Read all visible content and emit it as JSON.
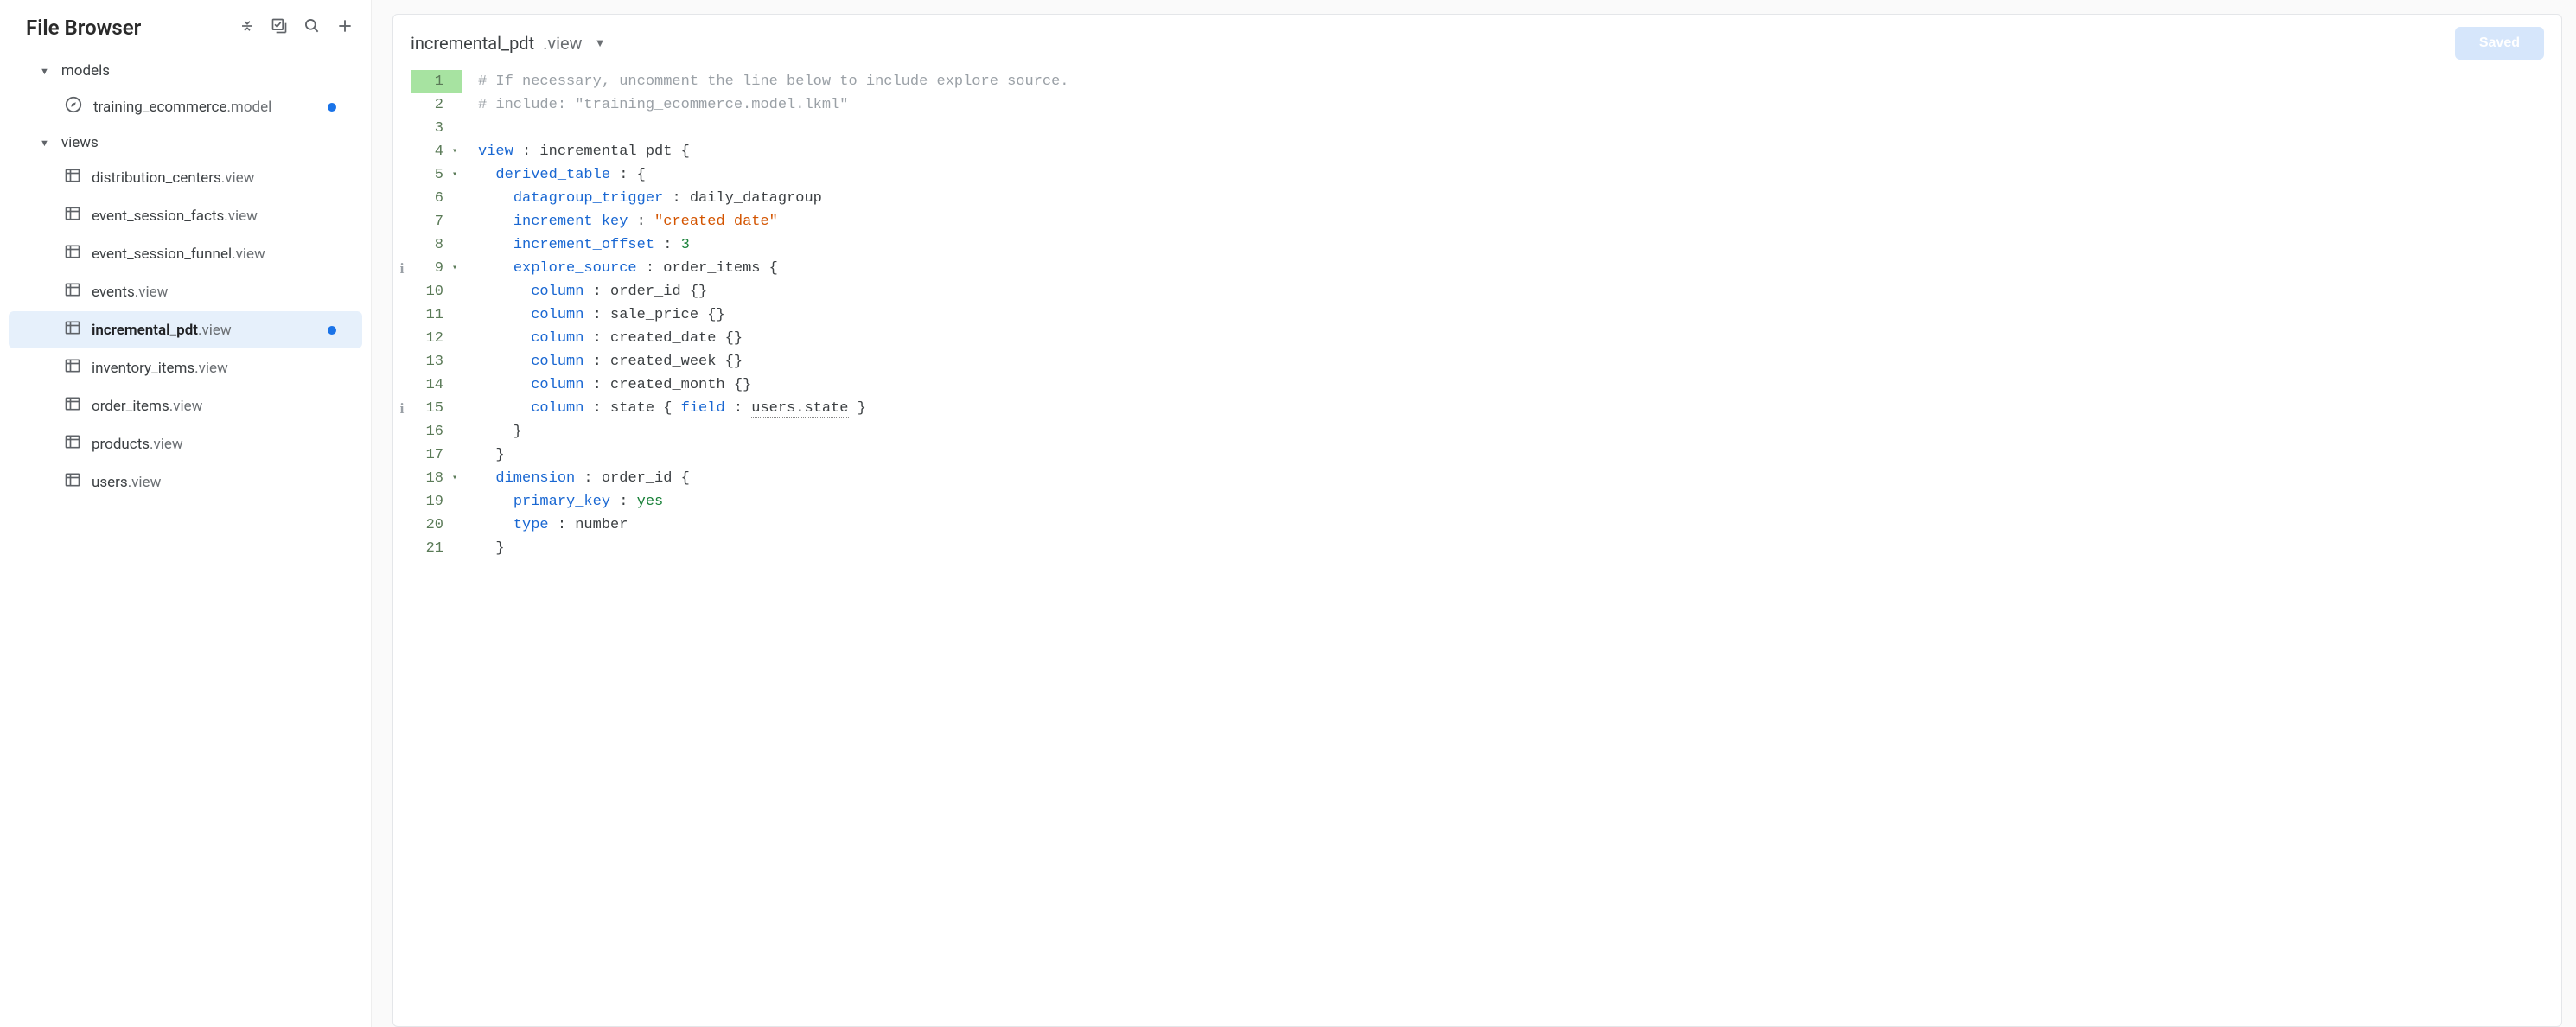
{
  "sidebar": {
    "title": "File Browser",
    "folders": {
      "models": {
        "label": "models"
      },
      "views": {
        "label": "views"
      }
    },
    "models": [
      {
        "name": "training_ecommerce",
        "ext": ".model",
        "dirty": true
      }
    ],
    "views": [
      {
        "name": "distribution_centers",
        "ext": ".view",
        "dirty": false,
        "active": false
      },
      {
        "name": "event_session_facts",
        "ext": ".view",
        "dirty": false,
        "active": false
      },
      {
        "name": "event_session_funnel",
        "ext": ".view",
        "dirty": false,
        "active": false
      },
      {
        "name": "events",
        "ext": ".view",
        "dirty": false,
        "active": false
      },
      {
        "name": "incremental_pdt",
        "ext": ".view",
        "dirty": true,
        "active": true
      },
      {
        "name": "inventory_items",
        "ext": ".view",
        "dirty": false,
        "active": false
      },
      {
        "name": "order_items",
        "ext": ".view",
        "dirty": false,
        "active": false
      },
      {
        "name": "products",
        "ext": ".view",
        "dirty": false,
        "active": false
      },
      {
        "name": "users",
        "ext": ".view",
        "dirty": false,
        "active": false
      }
    ]
  },
  "editor": {
    "filename_main": "incremental_pdt",
    "filename_ext": ".view",
    "status_label": "Saved",
    "lines": [
      {
        "n": 1,
        "info": "",
        "fold": "",
        "tokens": [
          [
            "c-comment",
            "# If necessary, uncomment the line below to include explore_source."
          ]
        ]
      },
      {
        "n": 2,
        "info": "",
        "fold": "",
        "tokens": [
          [
            "c-comment",
            "# include: \"training_ecommerce.model.lkml\""
          ]
        ]
      },
      {
        "n": 3,
        "info": "",
        "fold": "",
        "tokens": []
      },
      {
        "n": 4,
        "info": "",
        "fold": "▾",
        "tokens": [
          [
            "c-key",
            "view"
          ],
          [
            "",
            " : incremental_pdt {"
          ]
        ]
      },
      {
        "n": 5,
        "info": "",
        "fold": "▾",
        "tokens": [
          [
            "",
            "  "
          ],
          [
            "c-key",
            "derived_table"
          ],
          [
            "",
            " : {"
          ]
        ]
      },
      {
        "n": 6,
        "info": "",
        "fold": "",
        "tokens": [
          [
            "",
            "    "
          ],
          [
            "c-key",
            "datagroup_trigger"
          ],
          [
            "",
            " : daily_datagroup"
          ]
        ]
      },
      {
        "n": 7,
        "info": "",
        "fold": "",
        "tokens": [
          [
            "",
            "    "
          ],
          [
            "c-key",
            "increment_key"
          ],
          [
            "",
            " : "
          ],
          [
            "c-str",
            "\"created_date\""
          ]
        ]
      },
      {
        "n": 8,
        "info": "",
        "fold": "",
        "tokens": [
          [
            "",
            "    "
          ],
          [
            "c-key",
            "increment_offset"
          ],
          [
            "",
            " : "
          ],
          [
            "c-num",
            "3"
          ]
        ]
      },
      {
        "n": 9,
        "info": "i",
        "fold": "▾",
        "tokens": [
          [
            "",
            "    "
          ],
          [
            "c-key",
            "explore_source"
          ],
          [
            "",
            " : "
          ],
          [
            "c-dotted",
            "order_items"
          ],
          [
            "",
            " {"
          ]
        ]
      },
      {
        "n": 10,
        "info": "",
        "fold": "",
        "tokens": [
          [
            "",
            "      "
          ],
          [
            "c-key",
            "column"
          ],
          [
            "",
            " : order_id {}"
          ]
        ]
      },
      {
        "n": 11,
        "info": "",
        "fold": "",
        "tokens": [
          [
            "",
            "      "
          ],
          [
            "c-key",
            "column"
          ],
          [
            "",
            " : sale_price {}"
          ]
        ]
      },
      {
        "n": 12,
        "info": "",
        "fold": "",
        "tokens": [
          [
            "",
            "      "
          ],
          [
            "c-key",
            "column"
          ],
          [
            "",
            " : created_date {}"
          ]
        ]
      },
      {
        "n": 13,
        "info": "",
        "fold": "",
        "tokens": [
          [
            "",
            "      "
          ],
          [
            "c-key",
            "column"
          ],
          [
            "",
            " : created_week {}"
          ]
        ]
      },
      {
        "n": 14,
        "info": "",
        "fold": "",
        "tokens": [
          [
            "",
            "      "
          ],
          [
            "c-key",
            "column"
          ],
          [
            "",
            " : created_month {}"
          ]
        ]
      },
      {
        "n": 15,
        "info": "i",
        "fold": "",
        "tokens": [
          [
            "",
            "      "
          ],
          [
            "c-key",
            "column"
          ],
          [
            "",
            " : state { "
          ],
          [
            "c-key",
            "field"
          ],
          [
            "",
            " : "
          ],
          [
            "c-dotted",
            "users.state"
          ],
          [
            "",
            " }"
          ]
        ]
      },
      {
        "n": 16,
        "info": "",
        "fold": "",
        "tokens": [
          [
            "",
            "    }"
          ]
        ]
      },
      {
        "n": 17,
        "info": "",
        "fold": "",
        "tokens": [
          [
            "",
            "  }"
          ]
        ]
      },
      {
        "n": 18,
        "info": "",
        "fold": "▾",
        "tokens": [
          [
            "",
            "  "
          ],
          [
            "c-key",
            "dimension"
          ],
          [
            "",
            " : order_id {"
          ]
        ]
      },
      {
        "n": 19,
        "info": "",
        "fold": "",
        "tokens": [
          [
            "",
            "    "
          ],
          [
            "c-key",
            "primary_key"
          ],
          [
            "",
            " : "
          ],
          [
            "c-val",
            "yes"
          ]
        ]
      },
      {
        "n": 20,
        "info": "",
        "fold": "",
        "tokens": [
          [
            "",
            "    "
          ],
          [
            "c-key",
            "type"
          ],
          [
            "",
            " : number"
          ]
        ]
      },
      {
        "n": 21,
        "info": "",
        "fold": "",
        "tokens": [
          [
            "",
            "  }"
          ]
        ]
      }
    ]
  }
}
